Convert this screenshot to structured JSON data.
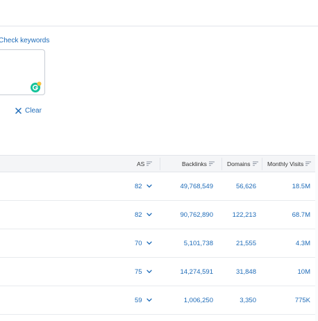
{
  "keywords": {
    "check_link": "Check keywords",
    "textarea_value": "",
    "clear_label": "Clear"
  },
  "table": {
    "headers": {
      "as": "AS",
      "backlinks": "Backlinks",
      "domains": "Domains",
      "monthly_visits": "Monthly Visits"
    },
    "rows": [
      {
        "as": "82",
        "backlinks": "49,768,549",
        "domains": "56,626",
        "monthly_visits": "18.5M"
      },
      {
        "as": "82",
        "backlinks": "90,762,890",
        "domains": "122,213",
        "monthly_visits": "68.7M"
      },
      {
        "as": "70",
        "backlinks": "5,101,738",
        "domains": "21,555",
        "monthly_visits": "4.3M"
      },
      {
        "as": "75",
        "backlinks": "14,274,591",
        "domains": "31,848",
        "monthly_visits": "10M"
      },
      {
        "as": "59",
        "backlinks": "1,006,250",
        "domains": "3,350",
        "monthly_visits": "775K"
      }
    ]
  },
  "colors": {
    "link": "#1e6bb8",
    "header_bg": "#f4f5f7",
    "border": "#e2e5ea",
    "grammarly_green": "#15c39a"
  },
  "icons": {
    "clear": "close-icon",
    "sort": "sort-lines-icon",
    "expand": "chevron-down-icon",
    "extension": "grammarly-icon"
  }
}
